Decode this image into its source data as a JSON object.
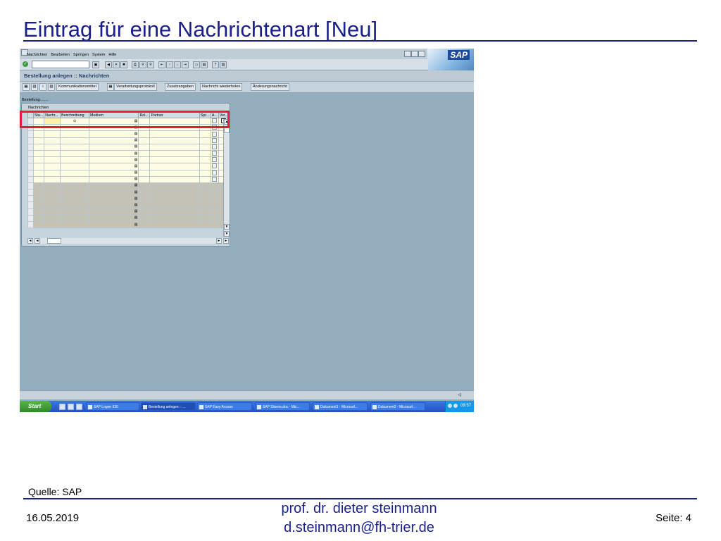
{
  "slide": {
    "title": "Eintrag für eine Nachrichtenart [Neu]",
    "source": "Quelle: SAP",
    "date": "16.05.2019",
    "author_name": "prof. dr. dieter steinmann",
    "author_email": "d.steinmann@fh-trier.de",
    "page": "Seite: 4"
  },
  "sap": {
    "menu": [
      "Nachrichten",
      "Bearbeiten",
      "Springen",
      "System",
      "Hilfe"
    ],
    "logo": "SAP",
    "screen_title": "Bestellung anlegen :: Nachrichten",
    "app_buttons": [
      "Kommunikationsmittel",
      "Verarbeitungsprotokoll",
      "Zusatzangaben",
      "Nachricht wiederholen",
      "Änderungsnachricht"
    ],
    "field_label": "Bestellung........",
    "table_title": "Nachrichten",
    "columns": [
      "Sta...",
      "Nachr...",
      "Beschreibung",
      "Medium",
      "Rol...",
      "Partner",
      "Spr...",
      "A...",
      "Ver..."
    ],
    "rows_input": 10,
    "rows_total": 17
  },
  "taskbar": {
    "start": "Start",
    "tasks": [
      "SAP Logon 620",
      "Bestellung anlegen :: ...",
      "SAP Easy Access",
      "SAP Sheets.doc - Mic...",
      "Dokument1 - Microsof...",
      "Dokument2 - Microsof..."
    ],
    "active_task": 1,
    "clock": "09:57"
  },
  "colors": {
    "title": "#1a1f8c",
    "sap_background": "#94aebf",
    "highlight": "#e41d34",
    "taskbar": "#2450c4"
  }
}
